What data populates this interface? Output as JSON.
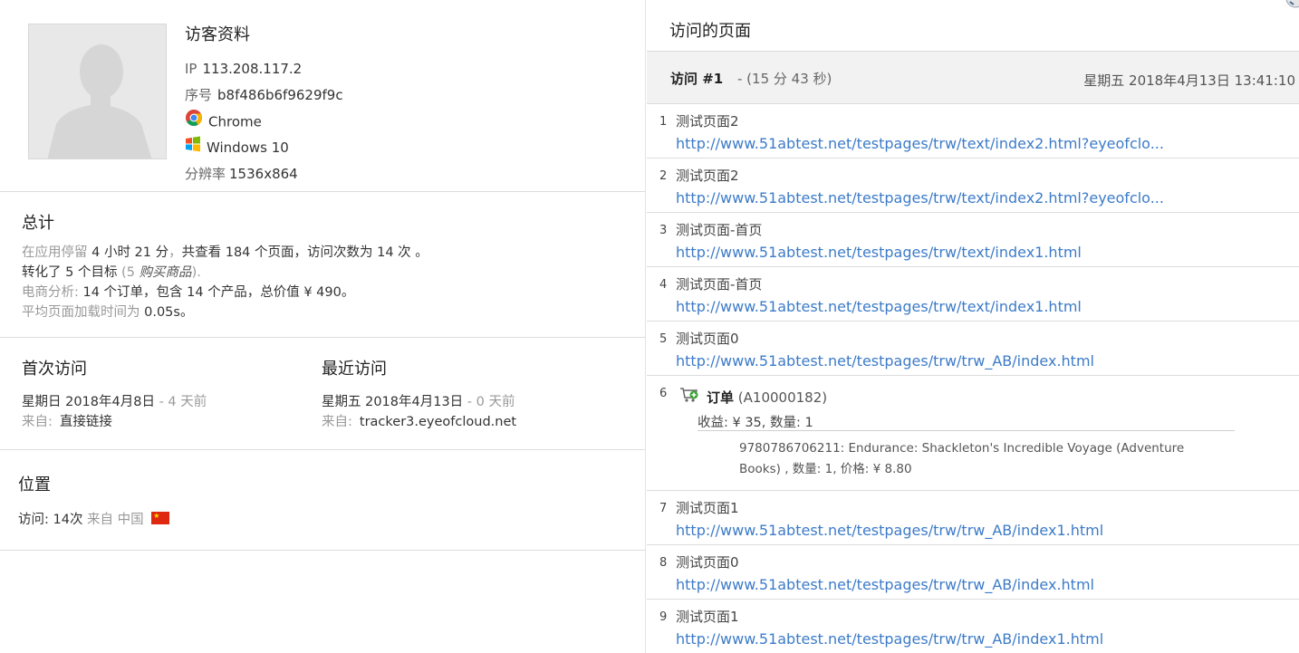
{
  "profile": {
    "title": "访客资料",
    "ip_label": "IP",
    "ip": "113.208.117.2",
    "id_label": "序号",
    "id": "b8f486b6f9629f9c",
    "browser": "Chrome",
    "os": "Windows 10",
    "res_label": "分辨率",
    "resolution": "1536x864"
  },
  "totals": {
    "title": "总计",
    "l1_a": "在应用停留",
    "l1_b": " 4 小时 21 分",
    "l1_c": "，",
    "l1_d": "共查看 184 个页面，访问次数为 14 次 。",
    "l2_a": "转化了 5 个目标",
    "l2_b": " (5 ",
    "l2_c": "购买商品",
    "l2_d": ").",
    "l3_a": "电商分析:",
    "l3_b": " 14 个订单，包含 14 个产品，总价值 ¥ 490。",
    "l4_a": "平均页面加载时间为",
    "l4_b": " 0.05s。"
  },
  "first_visit": {
    "title": "首次访问",
    "date": "星期日 2018年4月8日",
    "ago": " - 4 天前",
    "from_label": "来自:",
    "from": "直接链接"
  },
  "last_visit": {
    "title": "最近访问",
    "date": "星期五 2018年4月13日",
    "ago": " - 0 天前",
    "from_label": "来自:",
    "from": "tracker3.eyeofcloud.net"
  },
  "location": {
    "title": "位置",
    "visits": "访问: 14次",
    "from": "来自",
    "country": "中国"
  },
  "pages_panel": {
    "title": "访问的页面",
    "visit_title": "访问 #1",
    "visit_duration": "- (15 分 43 秒)",
    "visit_date": "星期五 2018年4月13日 13:41:10"
  },
  "pages": [
    {
      "num": "1",
      "title": "测试页面2",
      "url": "http://www.51abtest.net/testpages/trw/text/index2.html?eyeofclo..."
    },
    {
      "num": "2",
      "title": "测试页面2",
      "url": "http://www.51abtest.net/testpages/trw/text/index2.html?eyeofclo..."
    },
    {
      "num": "3",
      "title": "测试页面-首页",
      "url": "http://www.51abtest.net/testpages/trw/text/index1.html"
    },
    {
      "num": "4",
      "title": "测试页面-首页",
      "url": "http://www.51abtest.net/testpages/trw/text/index1.html"
    },
    {
      "num": "5",
      "title": "测试页面0",
      "url": "http://www.51abtest.net/testpages/trw/trw_AB/index.html"
    },
    {
      "num": "7",
      "title": "测试页面1",
      "url": "http://www.51abtest.net/testpages/trw/trw_AB/index1.html"
    },
    {
      "num": "8",
      "title": "测试页面0",
      "url": "http://www.51abtest.net/testpages/trw/trw_AB/index.html"
    },
    {
      "num": "9",
      "title": "测试页面1",
      "url": "http://www.51abtest.net/testpages/trw/trw_AB/index1.html"
    }
  ],
  "order": {
    "num": "6",
    "label": "订单",
    "id": " (A10000182)",
    "revenue_label": "收益: ¥ 35",
    "qty": ", 数量: 1",
    "item": "9780786706211: Endurance: Shackleton's Incredible Voyage (Adventure Books) , 数量: 1, 价格: ¥ 8.80"
  }
}
